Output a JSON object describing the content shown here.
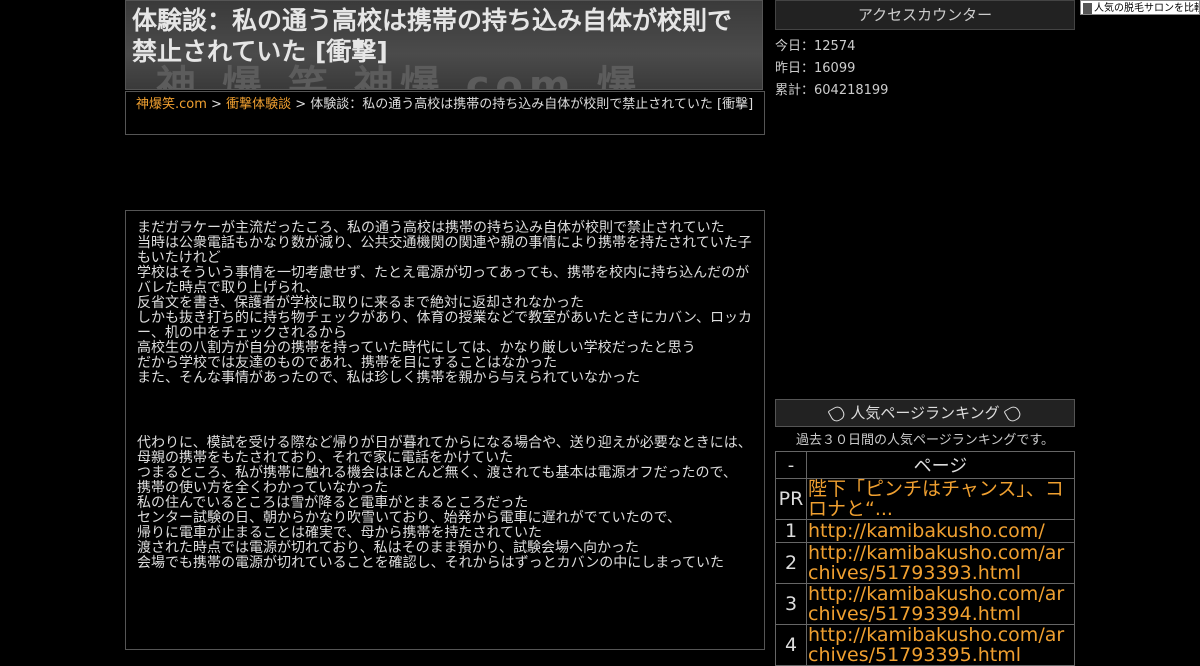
{
  "header": {
    "watermark": "神 爆 笑 神爆 com 爆",
    "title": "体験談：私の通う高校は携帯の持ち込み自体が校則で禁止されていた [衝撃]"
  },
  "breadcrumb": {
    "home": "神爆笑.com",
    "sep": " > ",
    "category": "衝撃体験談",
    "current": "体験談：私の通う高校は携帯の持ち込み自体が校則で禁止されていた [衝撃]"
  },
  "article": {
    "para1": [
      "まだガラケーが主流だったころ、私の通う高校は携帯の持ち込み自体が校則で禁止されていた",
      "当時は公衆電話もかなり数が減り、公共交通機関の関連や親の事情により携帯を持たされていた子もいたけれど",
      "学校はそういう事情を一切考慮せず、たとえ電源が切ってあっても、携帯を校内に持ち込んだのがバレた時点で取り上げられ、",
      "反省文を書き、保護者が学校に取りに来るまで絶対に返却されなかった",
      "しかも抜き打ち的に持ち物チェックがあり、体育の授業などで教室があいたときにカバン、ロッカー、机の中をチェックされるから",
      "高校生の八割方が自分の携帯を持っていた時代にしては、かなり厳しい学校だったと思う",
      "だから学校では友達のものであれ、携帯を目にすることはなかった",
      "また、そんな事情があったので、私は珍しく携帯を親から与えられていなかった"
    ],
    "para2": [
      "代わりに、模試を受ける際など帰りが日が暮れてからになる場合や、送り迎えが必要なときには、",
      "母親の携帯をもたされており、それで家に電話をかけていた",
      "つまるところ、私が携帯に触れる機会はほとんど無く、渡されても基本は電源オフだったので、",
      "携帯の使い方を全くわかっていなかった",
      "私の住んでいるところは雪が降ると電車がとまるところだった",
      "センター試験の日、朝からかなり吹雪いており、始発から電車に遅れがでていたので、",
      "帰りに電車が止まることは確実で、母から携帯を持たされていた",
      "渡された時点では電源が切れており、私はそのまま預かり、試験会場へ向かった",
      "会場でも携帯の電源が切れていることを確認し、それからはずっとカバンの中にしまっていた"
    ]
  },
  "sidebar": {
    "counter_title": "アクセスカウンター",
    "today": "今日：12574",
    "yesterday": "昨日：16099",
    "total": "累計：604218199",
    "ad_text": "人気の脱毛サロンを比較",
    "ranking_title": "人気ページランキング",
    "ranking_desc": "過去３０日間の人気ページランキングです。",
    "col_rank": "-",
    "col_page": "ページ",
    "rows": [
      {
        "rank": "PR",
        "page": "陛下「ピンチはチャンス」、コロナと“..."
      },
      {
        "rank": "1",
        "page": "http://kamibakusho.com/"
      },
      {
        "rank": "2",
        "page": "http://kamibakusho.com/archives/51793393.html"
      },
      {
        "rank": "3",
        "page": "http://kamibakusho.com/archives/51793394.html"
      },
      {
        "rank": "4",
        "page": "http://kamibakusho.com/archives/51793395.html"
      }
    ]
  }
}
